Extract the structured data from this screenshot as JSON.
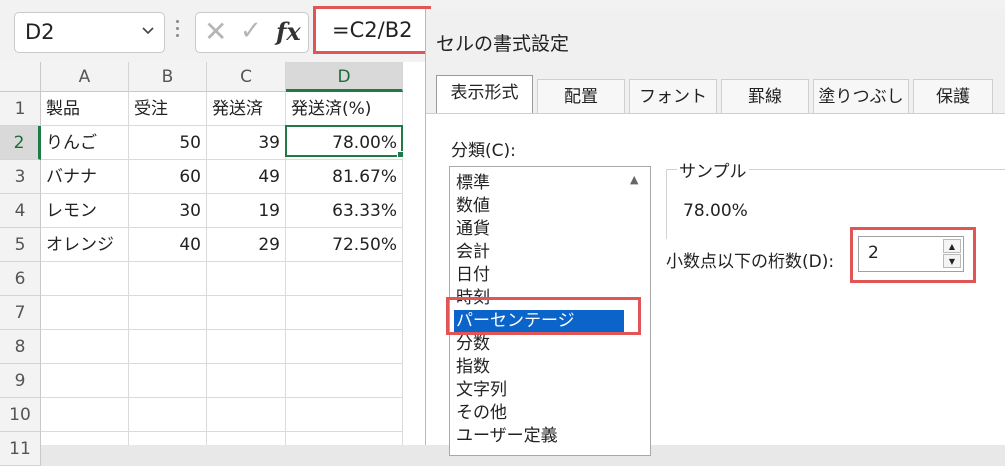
{
  "formula_bar": {
    "name_box": "D2",
    "formula": "=C2/B2"
  },
  "sheet": {
    "columns": [
      "A",
      "B",
      "C",
      "D"
    ],
    "rows": [
      "1",
      "2",
      "3",
      "4",
      "5",
      "6",
      "7",
      "8",
      "9",
      "10",
      "11"
    ],
    "headers": [
      "製品",
      "受注",
      "発送済",
      "発送済(%)"
    ],
    "data": [
      [
        "りんご",
        "50",
        "39",
        "78.00%"
      ],
      [
        "バナナ",
        "60",
        "49",
        "81.67%"
      ],
      [
        "レモン",
        "30",
        "19",
        "63.33%"
      ],
      [
        "オレンジ",
        "40",
        "29",
        "72.50%"
      ]
    ],
    "active_cell": "D2",
    "accent_color": "#1f7a45"
  },
  "dialog": {
    "title": "セルの書式設定",
    "tabs": [
      "表示形式",
      "配置",
      "フォント",
      "罫線",
      "塗りつぶし",
      "保護"
    ],
    "active_tab": "表示形式",
    "category_label": "分類(C):",
    "categories": [
      "標準",
      "数値",
      "通貨",
      "会計",
      "日付",
      "時刻",
      "パーセンテージ",
      "分数",
      "指数",
      "文字列",
      "その他",
      "ユーザー定義"
    ],
    "selected_category": "パーセンテージ",
    "sample_label": "サンプル",
    "sample_value": "78.00%",
    "decimal_label": "小数点以下の桁数(D):",
    "decimal_value": "2",
    "highlight_color": "#e25555",
    "selection_color": "#0a64c9"
  }
}
